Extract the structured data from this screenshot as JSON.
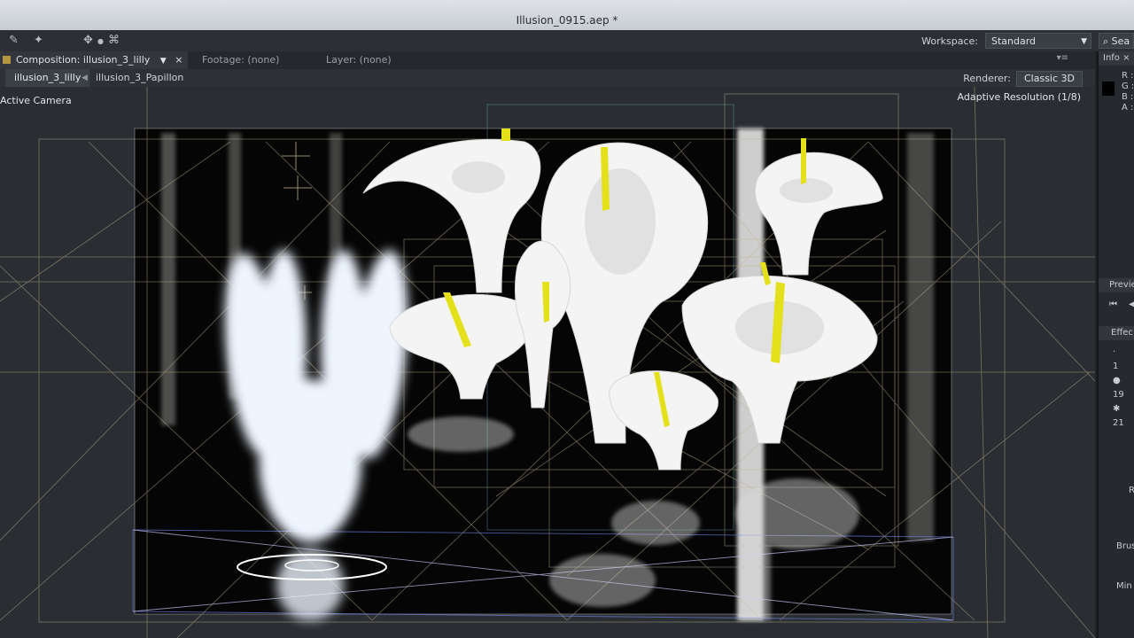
{
  "window": {
    "title": "Illusion_0915.aep *"
  },
  "toolbar": {
    "workspace_label": "Workspace:",
    "workspace_value": "Standard",
    "search_text": "Sea"
  },
  "panel": {
    "comp_tab": "Composition: illusion_3_lilly",
    "footage_tab": "Footage: (none)",
    "layer_tab": "Layer: (none)"
  },
  "breadcrumb": {
    "current": "illusion_3_lilly",
    "parent": "illusion_3_Papillon"
  },
  "viewer": {
    "camera": "Active Camera",
    "renderer_label": "Renderer:",
    "renderer_value": "Classic 3D",
    "resolution": "Adaptive Resolution (1/8)"
  },
  "info_panel": {
    "title": "Info",
    "channels": [
      "R :",
      "G :",
      "B :",
      "A :"
    ]
  },
  "preview_panel": {
    "title": "Previe"
  },
  "effects_panel": {
    "title": "Effec",
    "brush_sizes": [
      "1",
      "19",
      "21"
    ]
  },
  "brush_panel": {
    "r_label": "R",
    "brush_label": "Brus",
    "min_label": "Min"
  },
  "colors": {
    "bg": "#1f2226",
    "panel": "#2a2e33",
    "accent": "#b59640",
    "spadix": "#e4e01a"
  }
}
